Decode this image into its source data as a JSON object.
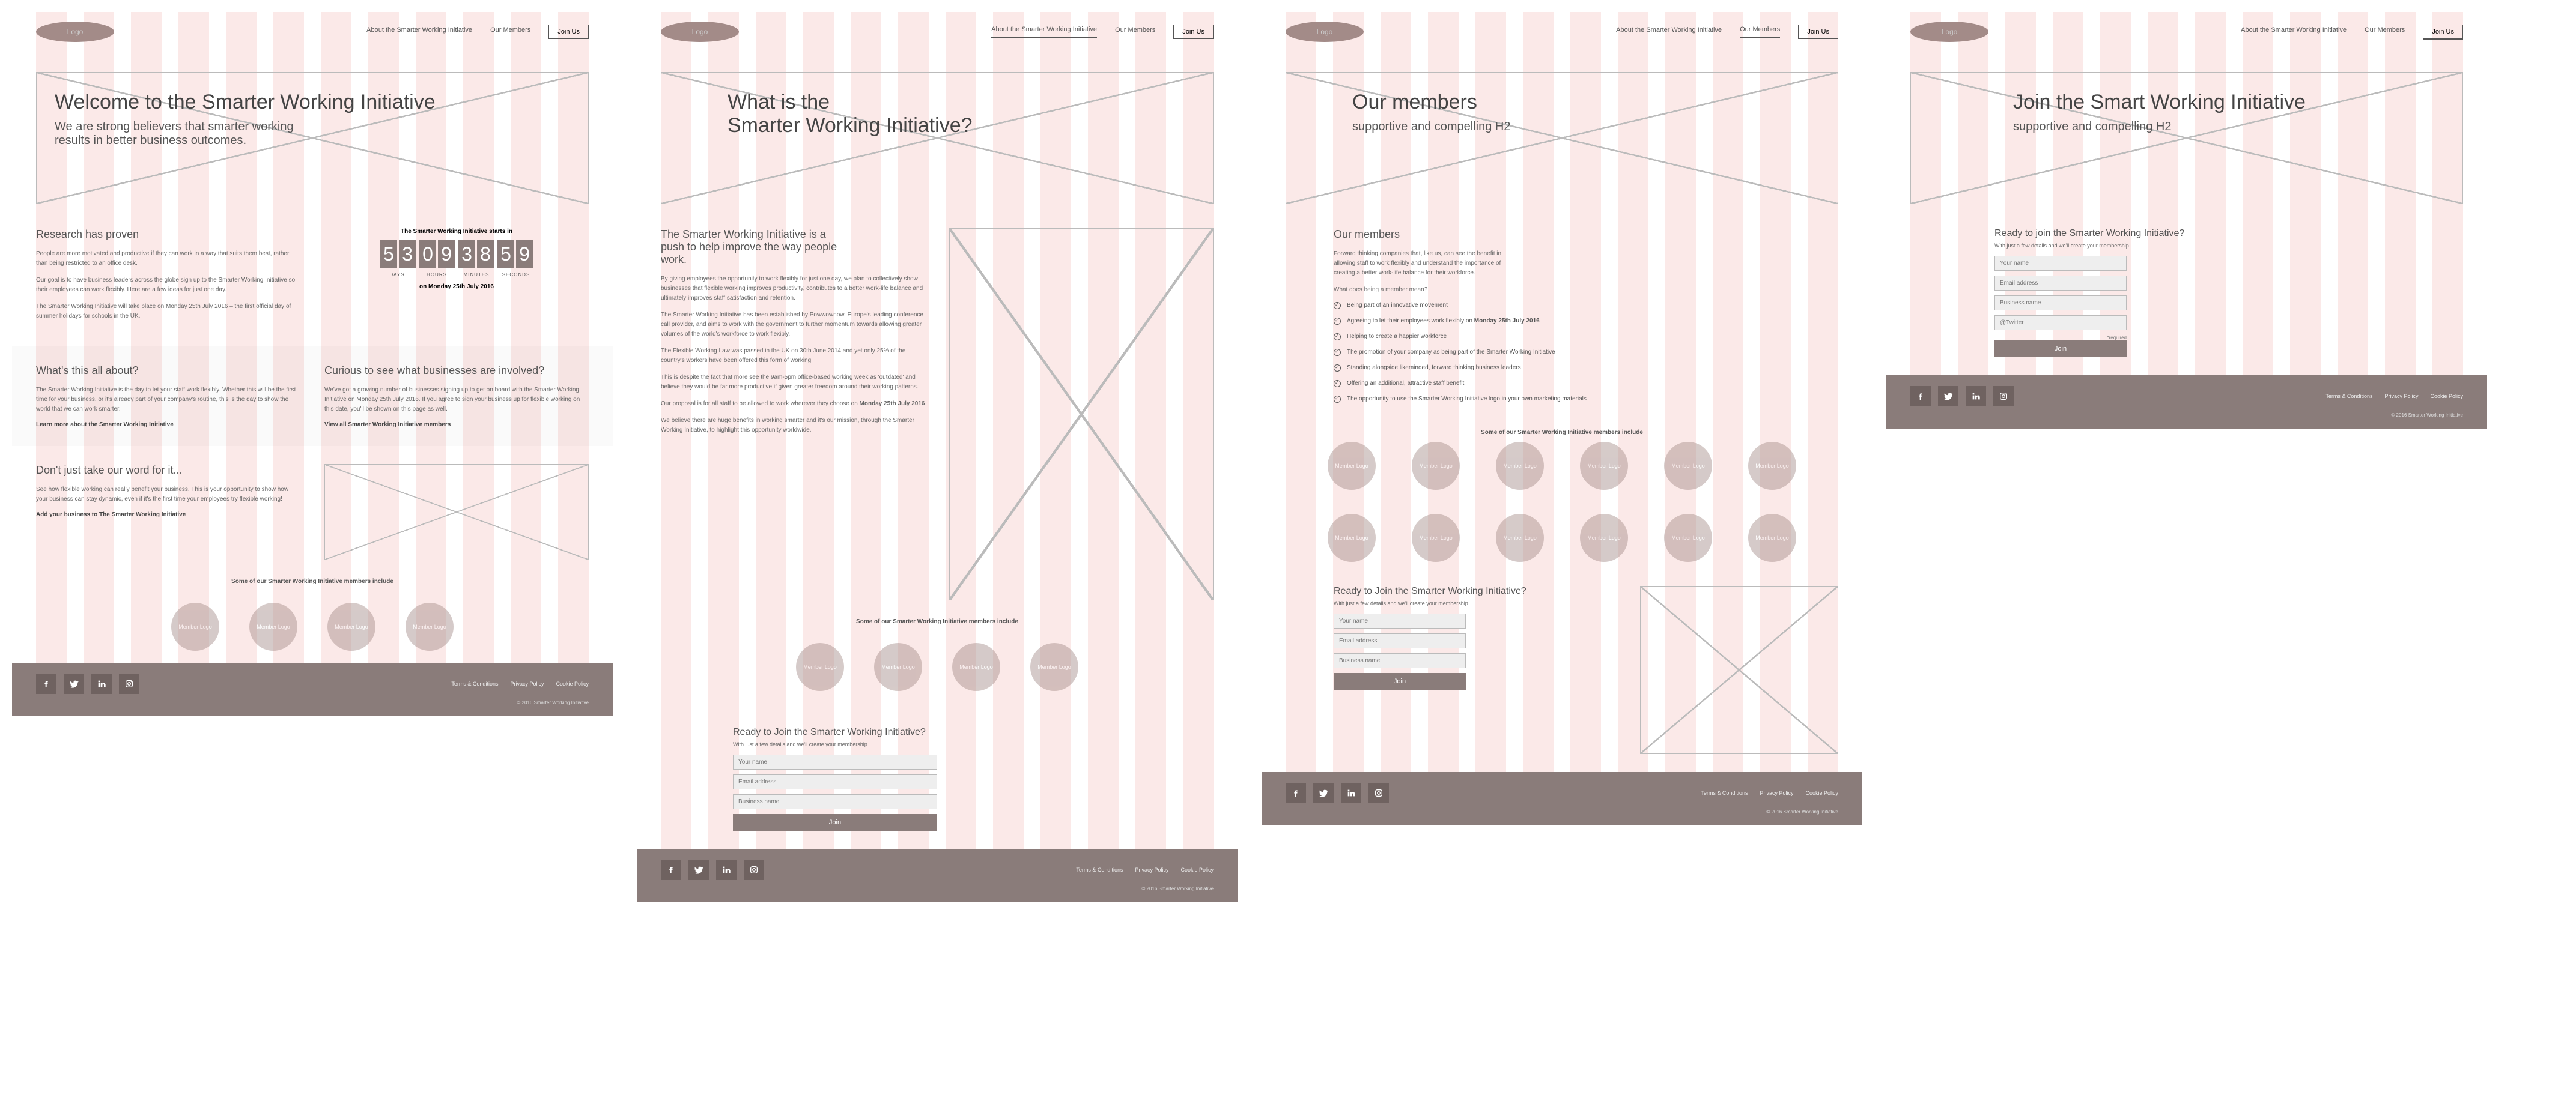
{
  "logo_text": "Logo",
  "nav": {
    "about": "About the Smarter Working Initiative",
    "members": "Our Members",
    "join": "Join Us"
  },
  "p1": {
    "hero_h1": "Welcome to the Smarter Working Initiative",
    "hero_h2a": "We are strong believers that smarter working",
    "hero_h2b": "results in better business outcomes.",
    "research_h": "Research has proven",
    "research_p1": "People are more motivated and productive if they can work in a way that suits them best, rather than being restricted to an office desk.",
    "research_p2": "Our goal is to have business leaders across the globe sign up to the Smarter Working Initiative so their employees can work flexibly. Here are a few ideas for just one day.",
    "research_p3": "The Smarter Working Initiative will take place on Monday 25th July 2016 – the first official day of summer holidays for schools in the UK.",
    "countdown_label": "The Smarter Working Initiative starts in",
    "cd": [
      "5",
      "3",
      "0",
      "9",
      "3",
      "8",
      "5",
      "9"
    ],
    "cd_caps": [
      "DAYS",
      "HOURS",
      "MINUTES",
      "SECONDS"
    ],
    "countdown_date": "on Monday 25th July 2016",
    "about_h": "What's this all about?",
    "about_p": "The Smarter Working Initiative is the day to let your staff work flexibly.  Whether this will be the first time for your business, or it's already part of your company's routine, this is the day to show the world that we can work smarter.",
    "about_link": "Learn more about the Smarter Working Initiative",
    "curious_h": "Curious to see what businesses are involved?",
    "curious_p": "We've got a growing number of businesses signing up to get on board with the Smarter Working Initiative on Monday 25th July 2016.  If you agree to sign your business up for flexible working on this date, you'll be shown on this page as well.",
    "curious_link": "View all Smarter Working Initiative members",
    "word_h": "Don't just take our word for it...",
    "word_p": "See how flexible working can really benefit your business. This is your opportunity to show how your business can stay dynamic, even if it's the first time your employees try flexible working!",
    "word_link": "Add your business to The Smarter Working Initiative"
  },
  "p2": {
    "hero_h1a": "What is the",
    "hero_h1b": "Smarter Working Initiative?",
    "s1_h": "The Smarter Working Initiative is a push to help improve the way people work.",
    "s1_p1": "By giving employees the opportunity to work flexibly for just one day, we plan to collectively show businesses that flexible working improves productivity,  contributes to a better work-life balance and ultimately improves staff satisfaction and retention.",
    "s1_p2": "The Smarter Working Initiative has been established by Powwownow, Europe's leading conference call provider, and aims to work with the government to further momentum towards allowing greater volumes of the world's workforce to work flexibly.",
    "s1_p3": "The Flexible Working Law was passed in the UK on 30th June 2014 and yet only 25% of the country's workers have been offered this form of working.",
    "s1_p4": "This is despite the fact that more see the 9am-5pm office-based working week as 'outdated' and believe they would be far more productive if given greater freedom around their working patterns.",
    "s1_p5_pre": "Our proposal is for all staff to be allowed to work wherever they choose on ",
    "s1_p5_date": "Monday 25th July 2016",
    "s1_p6": "We believe there are huge benefits in working smarter and it's our mission, through the Smarter Working Initiative, to highlight this opportunity worldwide."
  },
  "p3": {
    "hero_h1": "Our members",
    "hero_h2": "supportive and compelling H2",
    "members_h": "Our members",
    "members_p1": "Forward thinking companies that, like us, can see the benefit in allowing staff to work flexibly and understand the importance of creating a better work-life balance for their workforce.",
    "members_p2": "What does being a member mean?",
    "cl1": "Being part of an innovative movement",
    "cl2_pre": "Agreeing to let their employees work flexibly on ",
    "cl2_date": "Monday 25th July 2016",
    "cl3": "Helping to create a happier workforce",
    "cl4": "The promotion of your company as being part of the Smarter Working Initiative",
    "cl5": "Standing alongside likeminded, forward thinking business leaders",
    "cl6": "Offering an additional, attractive staff benefit",
    "cl7": "The opportunity to use the Smarter Working Initiative logo in your own marketing materials"
  },
  "p4": {
    "hero_h1": "Join the Smart Working Initiative",
    "hero_h2": "supportive and compelling H2"
  },
  "members_include": "Some of our Smarter Working Initiative members include",
  "member_logo": "Member Logo",
  "join": {
    "h1": "Ready to Join the Smarter Working Initiative?",
    "h2": "Ready to join the Smarter Working Initiative?",
    "sub": "With just a few details and we'll create your membership.",
    "name": "Your name",
    "email": "Email address",
    "biz": "Business name",
    "twitter": "@Twitter",
    "btn": "Join",
    "required": "*required"
  },
  "footer": {
    "terms": "Terms & Conditions",
    "privacy": "Privacy Policy",
    "cookie": "Cookie Policy",
    "copyright": "© 2016 Smarter Working Initiative"
  }
}
